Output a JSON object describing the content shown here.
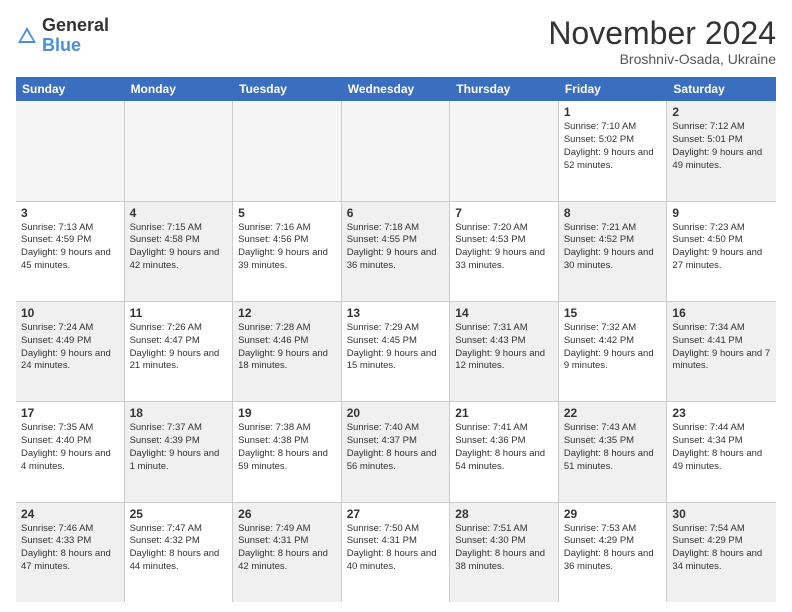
{
  "logo": {
    "general": "General",
    "blue": "Blue"
  },
  "header": {
    "month": "November 2024",
    "location": "Broshniv-Osada, Ukraine"
  },
  "days_of_week": [
    "Sunday",
    "Monday",
    "Tuesday",
    "Wednesday",
    "Thursday",
    "Friday",
    "Saturday"
  ],
  "rows": [
    [
      {
        "day": "",
        "info": "",
        "empty": true
      },
      {
        "day": "",
        "info": "",
        "empty": true
      },
      {
        "day": "",
        "info": "",
        "empty": true
      },
      {
        "day": "",
        "info": "",
        "empty": true
      },
      {
        "day": "",
        "info": "",
        "empty": true
      },
      {
        "day": "1",
        "info": "Sunrise: 7:10 AM\nSunset: 5:02 PM\nDaylight: 9 hours and 52 minutes."
      },
      {
        "day": "2",
        "info": "Sunrise: 7:12 AM\nSunset: 5:01 PM\nDaylight: 9 hours and 49 minutes.",
        "shaded": true
      }
    ],
    [
      {
        "day": "3",
        "info": "Sunrise: 7:13 AM\nSunset: 4:59 PM\nDaylight: 9 hours and 45 minutes."
      },
      {
        "day": "4",
        "info": "Sunrise: 7:15 AM\nSunset: 4:58 PM\nDaylight: 9 hours and 42 minutes.",
        "shaded": true
      },
      {
        "day": "5",
        "info": "Sunrise: 7:16 AM\nSunset: 4:56 PM\nDaylight: 9 hours and 39 minutes."
      },
      {
        "day": "6",
        "info": "Sunrise: 7:18 AM\nSunset: 4:55 PM\nDaylight: 9 hours and 36 minutes.",
        "shaded": true
      },
      {
        "day": "7",
        "info": "Sunrise: 7:20 AM\nSunset: 4:53 PM\nDaylight: 9 hours and 33 minutes."
      },
      {
        "day": "8",
        "info": "Sunrise: 7:21 AM\nSunset: 4:52 PM\nDaylight: 9 hours and 30 minutes.",
        "shaded": true
      },
      {
        "day": "9",
        "info": "Sunrise: 7:23 AM\nSunset: 4:50 PM\nDaylight: 9 hours and 27 minutes."
      }
    ],
    [
      {
        "day": "10",
        "info": "Sunrise: 7:24 AM\nSunset: 4:49 PM\nDaylight: 9 hours and 24 minutes.",
        "shaded": true
      },
      {
        "day": "11",
        "info": "Sunrise: 7:26 AM\nSunset: 4:47 PM\nDaylight: 9 hours and 21 minutes."
      },
      {
        "day": "12",
        "info": "Sunrise: 7:28 AM\nSunset: 4:46 PM\nDaylight: 9 hours and 18 minutes.",
        "shaded": true
      },
      {
        "day": "13",
        "info": "Sunrise: 7:29 AM\nSunset: 4:45 PM\nDaylight: 9 hours and 15 minutes."
      },
      {
        "day": "14",
        "info": "Sunrise: 7:31 AM\nSunset: 4:43 PM\nDaylight: 9 hours and 12 minutes.",
        "shaded": true
      },
      {
        "day": "15",
        "info": "Sunrise: 7:32 AM\nSunset: 4:42 PM\nDaylight: 9 hours and 9 minutes."
      },
      {
        "day": "16",
        "info": "Sunrise: 7:34 AM\nSunset: 4:41 PM\nDaylight: 9 hours and 7 minutes.",
        "shaded": true
      }
    ],
    [
      {
        "day": "17",
        "info": "Sunrise: 7:35 AM\nSunset: 4:40 PM\nDaylight: 9 hours and 4 minutes."
      },
      {
        "day": "18",
        "info": "Sunrise: 7:37 AM\nSunset: 4:39 PM\nDaylight: 9 hours and 1 minute.",
        "shaded": true
      },
      {
        "day": "19",
        "info": "Sunrise: 7:38 AM\nSunset: 4:38 PM\nDaylight: 8 hours and 59 minutes."
      },
      {
        "day": "20",
        "info": "Sunrise: 7:40 AM\nSunset: 4:37 PM\nDaylight: 8 hours and 56 minutes.",
        "shaded": true
      },
      {
        "day": "21",
        "info": "Sunrise: 7:41 AM\nSunset: 4:36 PM\nDaylight: 8 hours and 54 minutes."
      },
      {
        "day": "22",
        "info": "Sunrise: 7:43 AM\nSunset: 4:35 PM\nDaylight: 8 hours and 51 minutes.",
        "shaded": true
      },
      {
        "day": "23",
        "info": "Sunrise: 7:44 AM\nSunset: 4:34 PM\nDaylight: 8 hours and 49 minutes."
      }
    ],
    [
      {
        "day": "24",
        "info": "Sunrise: 7:46 AM\nSunset: 4:33 PM\nDaylight: 8 hours and 47 minutes.",
        "shaded": true
      },
      {
        "day": "25",
        "info": "Sunrise: 7:47 AM\nSunset: 4:32 PM\nDaylight: 8 hours and 44 minutes."
      },
      {
        "day": "26",
        "info": "Sunrise: 7:49 AM\nSunset: 4:31 PM\nDaylight: 8 hours and 42 minutes.",
        "shaded": true
      },
      {
        "day": "27",
        "info": "Sunrise: 7:50 AM\nSunset: 4:31 PM\nDaylight: 8 hours and 40 minutes."
      },
      {
        "day": "28",
        "info": "Sunrise: 7:51 AM\nSunset: 4:30 PM\nDaylight: 8 hours and 38 minutes.",
        "shaded": true
      },
      {
        "day": "29",
        "info": "Sunrise: 7:53 AM\nSunset: 4:29 PM\nDaylight: 8 hours and 36 minutes."
      },
      {
        "day": "30",
        "info": "Sunrise: 7:54 AM\nSunset: 4:29 PM\nDaylight: 8 hours and 34 minutes.",
        "shaded": true
      }
    ]
  ]
}
